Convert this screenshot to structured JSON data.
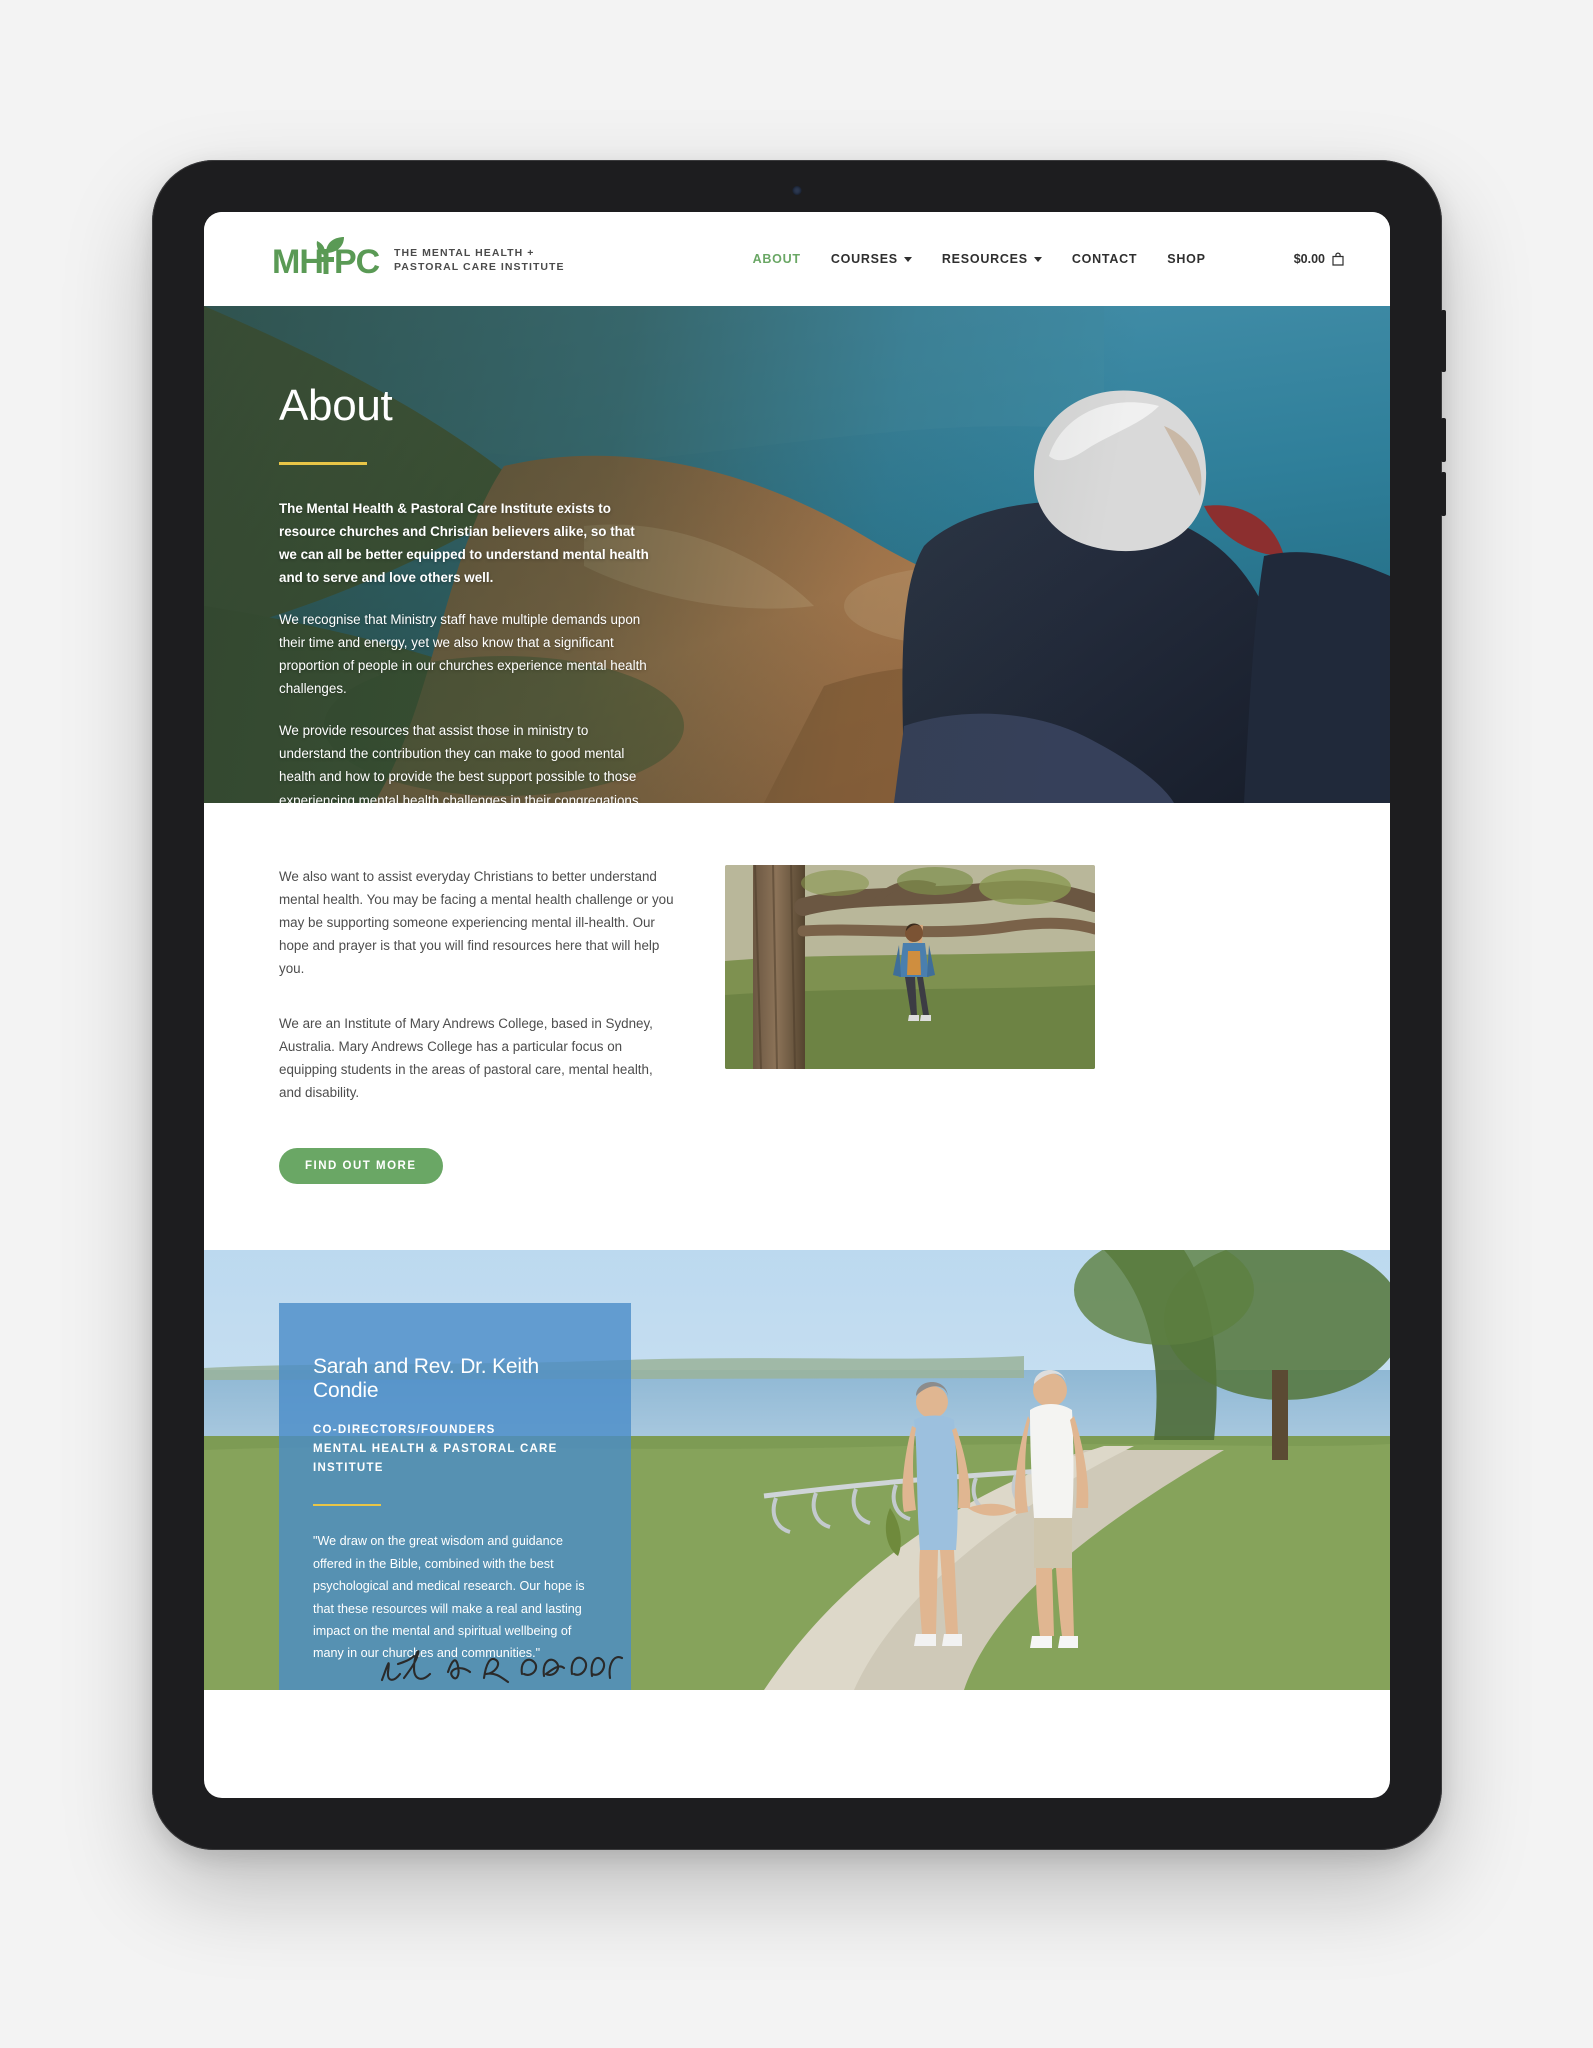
{
  "device": {
    "type": "tablet",
    "camera": "front-camera"
  },
  "header": {
    "logo": {
      "mark_text": "MH PC",
      "tagline": "THE MENTAL HEALTH +\nPASTORAL CARE INSTITUTE",
      "icon": "sprout-leaf-icon"
    },
    "nav": [
      {
        "label": "ABOUT",
        "active": true,
        "has_dropdown": false
      },
      {
        "label": "COURSES",
        "active": false,
        "has_dropdown": true
      },
      {
        "label": "RESOURCES",
        "active": false,
        "has_dropdown": true
      },
      {
        "label": "CONTACT",
        "active": false,
        "has_dropdown": false
      },
      {
        "label": "SHOP",
        "active": false,
        "has_dropdown": false
      }
    ],
    "cart": {
      "amount": "$0.00",
      "icon": "shopping-bag-icon"
    }
  },
  "hero": {
    "title": "About",
    "image_alt": "Man in dark jacket sitting on coastal rocks looking out over the sea",
    "paragraphs": [
      "The Mental Health & Pastoral Care Institute exists to resource churches and Christian believers alike, so that we can all be better equipped to understand mental health and to serve and love others well.",
      "We recognise that Ministry staff have multiple demands upon their time and energy, yet we also know that a significant proportion of people in our churches experience mental health challenges.",
      "We provide resources that assist those in ministry to understand the contribution they can make to good mental health and how to provide the best support possible to those experiencing mental health challenges in their congregations and communities."
    ]
  },
  "mid_section": {
    "paragraphs": [
      "We also want to assist everyday Christians to better understand mental health. You may be facing a mental health challenge or you may be supporting someone experiencing mental ill-health. Our hope and prayer is that you will find resources here that will help you.",
      "We are an Institute of Mary Andrews College, based in Sydney, Australia. Mary Andrews College has a particular focus on equipping students in the areas of pastoral care, mental health, and disability."
    ],
    "button_label": "FIND OUT MORE",
    "image_alt": "Child in denim jacket hanging from a tree branch in a park"
  },
  "testimonial": {
    "name": "Sarah and Rev. Dr. Keith Condie",
    "role": "CO-DIRECTORS/FOUNDERS\nMENTAL HEALTH & PASTORAL CARE INSTITUTE",
    "quote": "\"We draw on the great wisdom and guidance offered in the Bible, combined with the best psychological and medical research. Our hope is that these resources will make a real and lasting impact on the mental and spiritual wellbeing of many in our churches and communities.\"",
    "signature": "Keith & Sarah Condie",
    "image_alt": "Older couple walking hand in hand along a waterside path"
  },
  "colors": {
    "brand_green": "#6aa765",
    "accent_gold": "#e8c547",
    "panel_blue": "#4a8cc8",
    "text_dark": "#2f2f2f",
    "body_grey": "#4d4d4d"
  }
}
